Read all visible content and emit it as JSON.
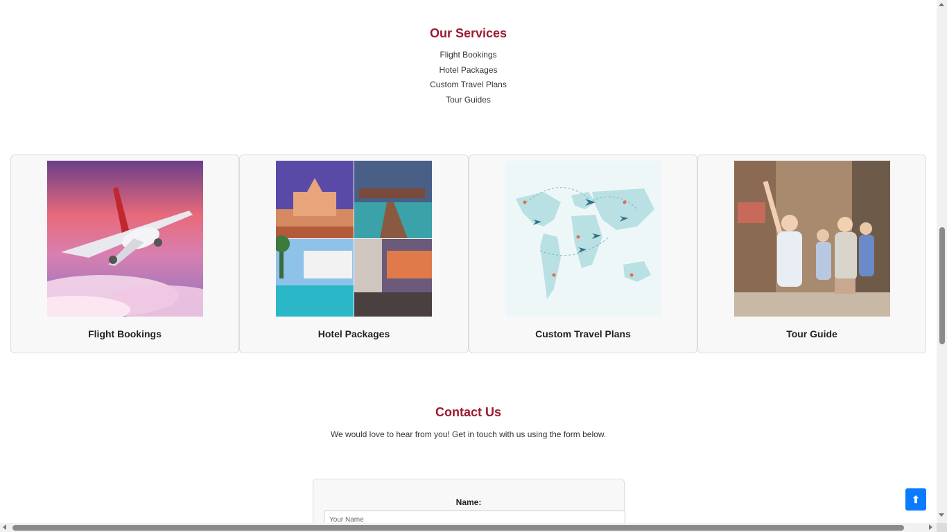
{
  "services": {
    "title": "Our Services",
    "items": [
      "Flight Bookings",
      "Hotel Packages",
      "Custom Travel Plans",
      "Tour Guides"
    ]
  },
  "cards": [
    {
      "label": "Flight Bookings",
      "image": "airplane-in-clouds-photo"
    },
    {
      "label": "Hotel Packages",
      "image": "hotel-collage-photo"
    },
    {
      "label": "Custom Travel Plans",
      "image": "world-map-flights-illustration"
    },
    {
      "label": "Tour Guide",
      "image": "tour-group-photo"
    }
  ],
  "contact": {
    "title": "Contact Us",
    "subtitle": "We would love to hear from you! Get in touch with us using the form below.",
    "name_label": "Name:",
    "name_placeholder": "Your Name"
  },
  "back_to_top": {
    "icon": "arrow-up-icon",
    "glyph": "⬆",
    "color": "#0a7bff"
  },
  "colors": {
    "accent": "#9b1b30",
    "button": "#0a7bff"
  }
}
